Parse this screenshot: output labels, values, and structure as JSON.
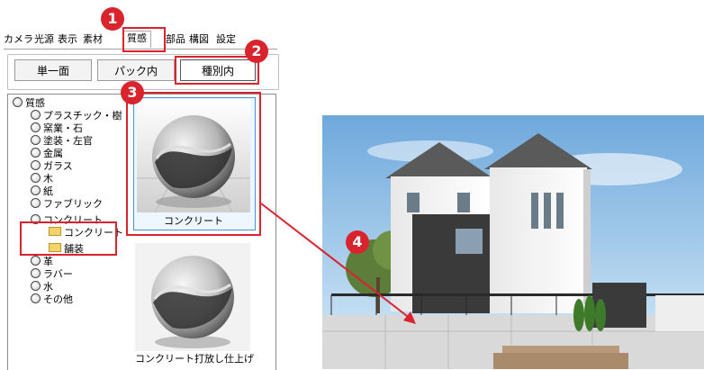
{
  "tabs": [
    {
      "label": "カメラ"
    },
    {
      "label": "光源"
    },
    {
      "label": "表示"
    },
    {
      "label": "素材"
    },
    {
      "label": "質感",
      "active": true
    },
    {
      "label": "部品"
    },
    {
      "label": "構図"
    },
    {
      "label": "設定"
    }
  ],
  "scope_buttons": {
    "single": "単一面",
    "pack": "パック内",
    "category": "種別内",
    "selected": "category"
  },
  "tree": {
    "root": "質感",
    "items": [
      {
        "label": "プラスチック・樹脂"
      },
      {
        "label": "窯業・石"
      },
      {
        "label": "塗装・左官"
      },
      {
        "label": "金属"
      },
      {
        "label": "ガラス"
      },
      {
        "label": "木"
      },
      {
        "label": "紙"
      },
      {
        "label": "ファブリック"
      },
      {
        "label": "コンクリート"
      },
      {
        "label": "コンクリート",
        "type": "folder"
      },
      {
        "label": "舗装",
        "type": "folder"
      },
      {
        "label": "革"
      },
      {
        "label": "ラバー"
      },
      {
        "label": "水"
      },
      {
        "label": "その他"
      }
    ]
  },
  "materials": [
    {
      "label": "コンクリート",
      "selected": true
    },
    {
      "label": "コンクリート打放し仕上げ"
    }
  ],
  "callouts": [
    "1",
    "2",
    "3",
    "4"
  ],
  "colors": {
    "highlight": "#d9232d",
    "selection": "#4a90d9",
    "sky": "#8fbfe8"
  }
}
